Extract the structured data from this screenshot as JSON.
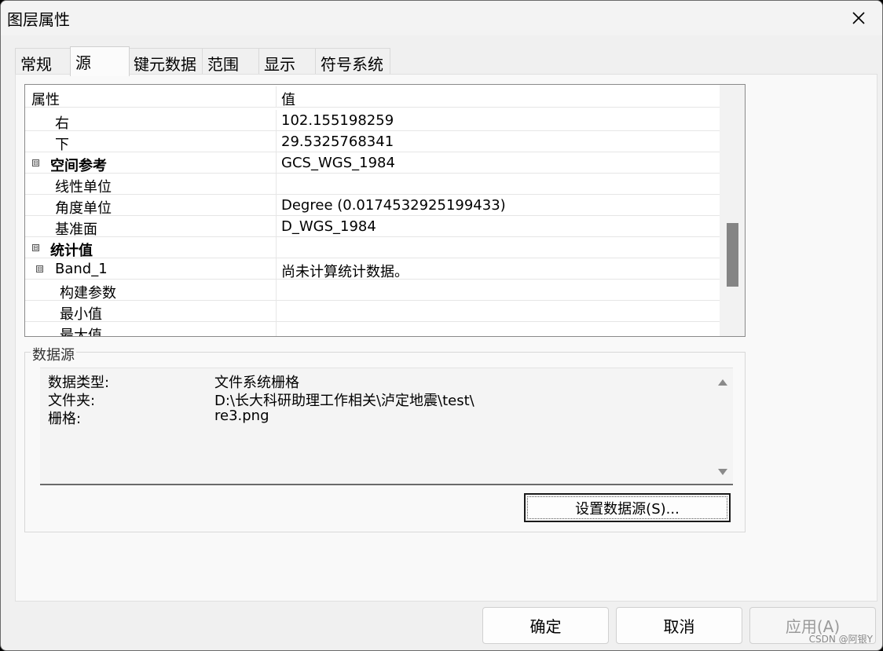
{
  "window": {
    "title": "图层属性"
  },
  "tabs": [
    {
      "label": "常规"
    },
    {
      "label": "源"
    },
    {
      "label": "键元数据"
    },
    {
      "label": "范围"
    },
    {
      "label": "显示"
    },
    {
      "label": "符号系统"
    }
  ],
  "active_tab": "源",
  "grid": {
    "header": {
      "property": "属性",
      "value": "值"
    },
    "rows": [
      {
        "label": "右",
        "value": "102.155198259"
      },
      {
        "label": "下",
        "value": "29.5325768341"
      },
      {
        "label": "空间参考",
        "value": "GCS_WGS_1984"
      },
      {
        "label": "线性单位",
        "value": ""
      },
      {
        "label": "角度单位",
        "value": "Degree (0.0174532925199433)"
      },
      {
        "label": "基准面",
        "value": "D_WGS_1984"
      },
      {
        "label": "统计值",
        "value": ""
      },
      {
        "label": "Band_1",
        "value": "尚未计算统计数据。"
      },
      {
        "label": "构建参数",
        "value": ""
      },
      {
        "label": "最小值",
        "value": ""
      },
      {
        "label": "最大值",
        "value": ""
      }
    ],
    "collapse_glyph": "⊟"
  },
  "datasource": {
    "group_label": "数据源",
    "rows": [
      {
        "key": "数据类型:",
        "value": "文件系统栅格"
      },
      {
        "key": "文件夹:",
        "value": "D:\\长大科研助理工作相关\\泸定地震\\test\\"
      },
      {
        "key": "栅格:",
        "value": "re3.png"
      }
    ],
    "set_button": "设置数据源(S)..."
  },
  "footer": {
    "ok": "确定",
    "cancel": "取消",
    "apply": "应用(A)"
  },
  "watermark": "CSDN @阿银Y"
}
